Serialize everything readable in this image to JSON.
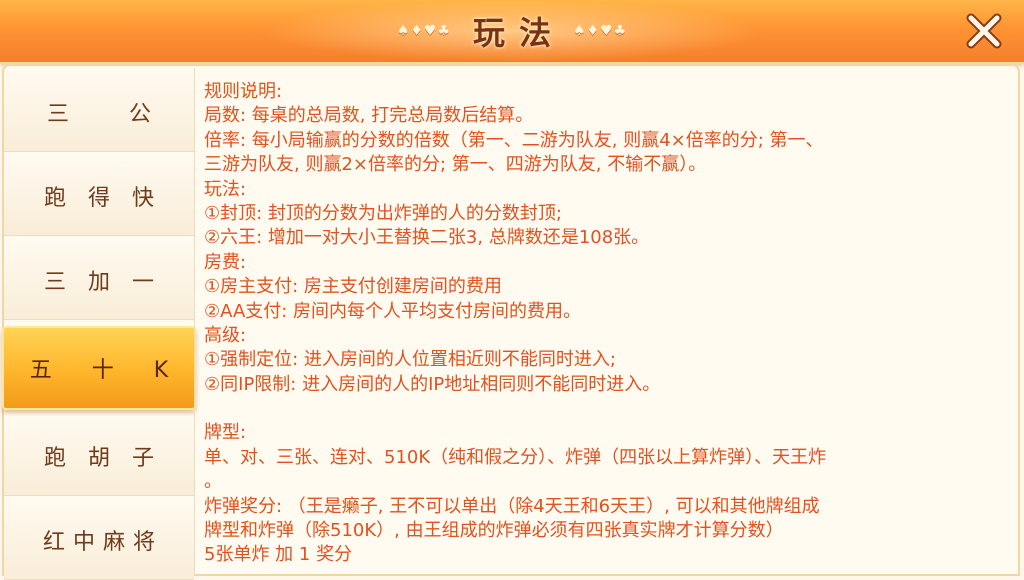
{
  "header": {
    "title": "玩法",
    "suits_left": "♠♦♥♣",
    "suits_right": "♠♦♥♣"
  },
  "close_icon": "close-x-icon",
  "sidebar": {
    "tabs": [
      {
        "label": "三公",
        "active": false
      },
      {
        "label": "跑得快",
        "active": false
      },
      {
        "label": "三加一",
        "active": false
      },
      {
        "label": "五十K",
        "active": true
      },
      {
        "label": "跑胡子",
        "active": false
      },
      {
        "label": "红中麻将",
        "active": false
      }
    ]
  },
  "content": {
    "lines": [
      "规则说明:",
      "局数: 每桌的总局数, 打完总局数后结算。",
      "倍率: 每小局输赢的分数的倍数（第一、二游为队友, 则赢4×倍率的分; 第一、",
      "三游为队友, 则赢2×倍率的分; 第一、四游为队友, 不输不赢）。",
      "玩法:",
      "①封顶: 封顶的分数为出炸弹的人的分数封顶;",
      "②六王: 增加一对大小王替换二张3, 总牌数还是108张。",
      "房费:",
      "①房主支付: 房主支付创建房间的费用",
      "②AA支付: 房间内每个人平均支付房间的费用。",
      "高级:",
      "①强制定位: 进入房间的人位置相近则不能同时进入;",
      "②同IP限制: 进入房间的人的IP地址相同则不能同时进入。",
      "",
      "牌型:",
      "单、对、三张、连对、510K（纯和假之分）、炸弹（四张以上算炸弹）、天王炸",
      "。",
      "炸弹奖分: （王是癞子, 王不可以单出（除4天王和6天王）, 可以和其他牌组成",
      "牌型和炸弹（除510K）, 由王组成的炸弹必须有四张真实牌才计算分数）",
      "5张单炸 加 1 奖分"
    ]
  },
  "colors": {
    "header_orange": "#ff9433",
    "title_brown": "#7a3212",
    "content_text": "#e2521e",
    "tab_active": "#ffb52b"
  }
}
